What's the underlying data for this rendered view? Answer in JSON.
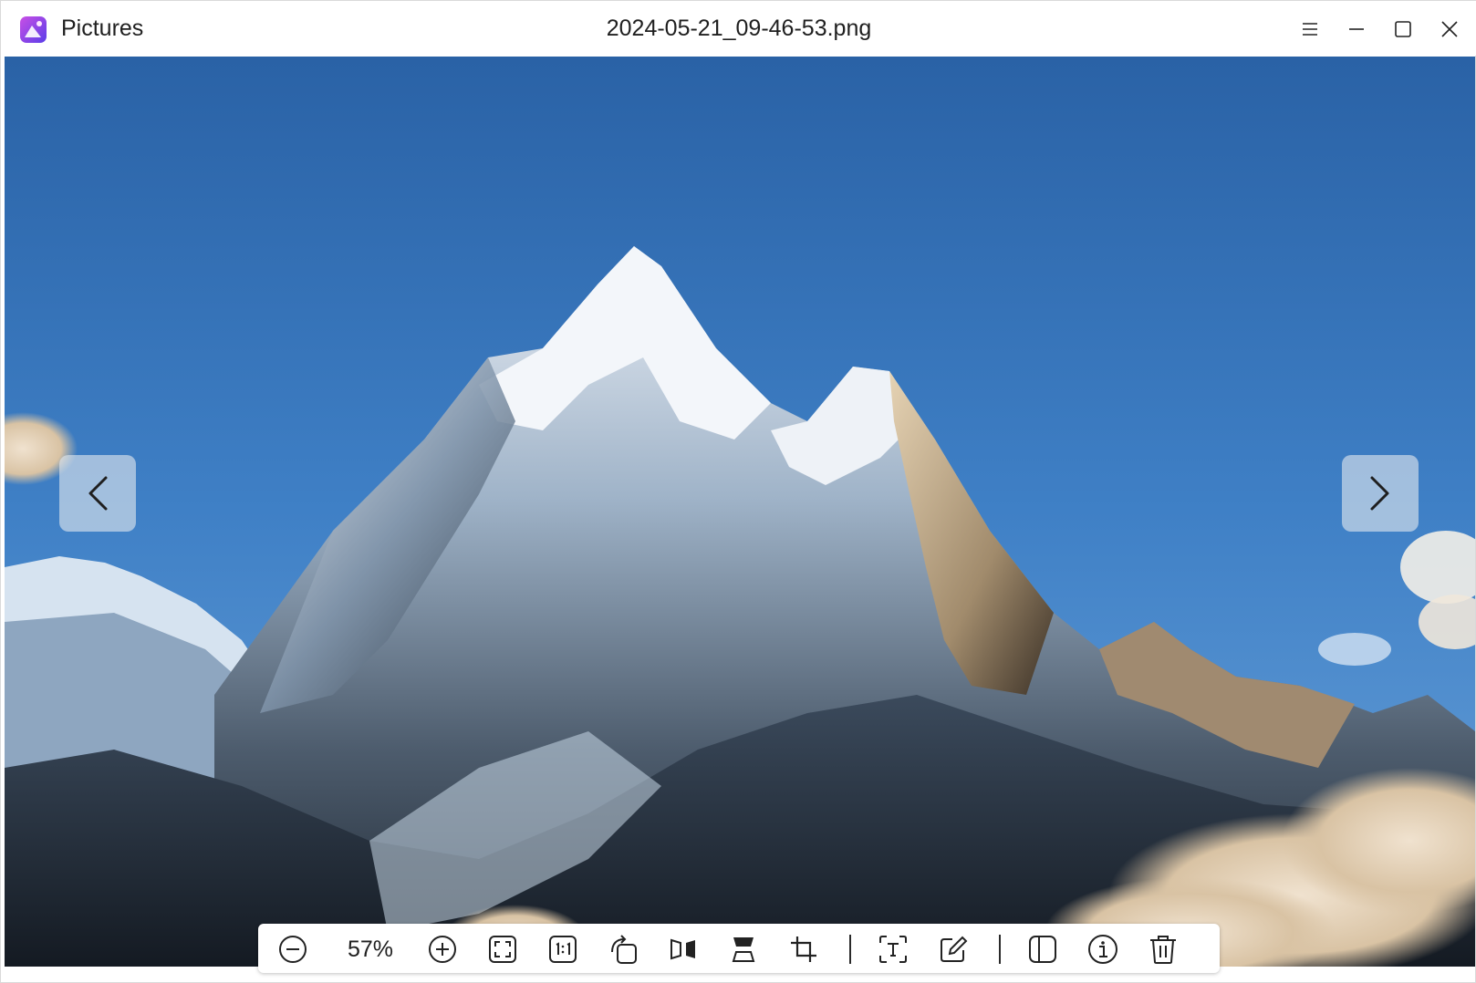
{
  "app": {
    "name": "Pictures",
    "icon": "pictures-app-icon"
  },
  "window": {
    "title": "2024-05-21_09-46-53.png",
    "controls": [
      "menu-icon",
      "minimize-icon",
      "maximize-icon",
      "close-icon"
    ]
  },
  "viewer": {
    "image_subject": "mountain-photo",
    "prev_icon": "chevron-left-icon",
    "next_icon": "chevron-right-icon"
  },
  "toolbar": {
    "zoom_level": "57%",
    "buttons": [
      "zoom-out-icon",
      "zoom-in-icon",
      "fit-to-window-icon",
      "actual-size-icon",
      "rotate-icon",
      "flip-horizontal-icon",
      "flip-vertical-icon",
      "crop-icon",
      "text-recognition-icon",
      "edit-icon",
      "side-panel-icon",
      "info-icon",
      "delete-icon"
    ]
  },
  "colors": {
    "sky_top": "#2a62a6",
    "sky_bottom": "#6ba3da",
    "app_icon_accent": "#8b45e8"
  }
}
